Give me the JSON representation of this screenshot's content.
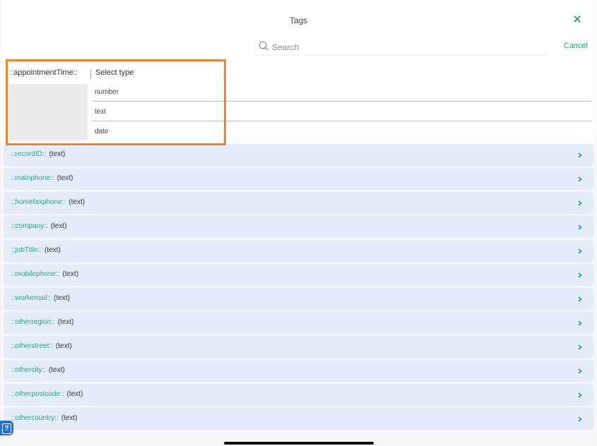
{
  "header": {
    "title": "Tags",
    "close_icon": "x-icon",
    "search_placeholder": "Search",
    "cancel_label": "Cancel"
  },
  "tag_editor": {
    "tag_prefix": "::",
    "tag_name": "appointmentTime",
    "tag_suffix": "::",
    "select_label": "Select type",
    "options": [
      "number",
      "text",
      "date"
    ]
  },
  "fields": [
    {
      "name": "::recordID::",
      "type": "(text)"
    },
    {
      "name": "::mainphone::",
      "type": "(text)"
    },
    {
      "name": "::homefaxphone::",
      "type": "(text)"
    },
    {
      "name": "::company::",
      "type": "(text)"
    },
    {
      "name": "::jobTitle::",
      "type": "(text)"
    },
    {
      "name": "::mobilephone::",
      "type": "(text)"
    },
    {
      "name": "::workemail::",
      "type": "(text)"
    },
    {
      "name": "::otherregion::",
      "type": "(text)"
    },
    {
      "name": "::otherstreet::",
      "type": "(text)"
    },
    {
      "name": "::othercity::",
      "type": "(text)"
    },
    {
      "name": "::otherpostcode::",
      "type": "(text)"
    },
    {
      "name": "::othercountry::",
      "type": "(text)"
    }
  ],
  "colors": {
    "accent": "#1e9e7e",
    "highlight": "#f5832b",
    "row_background": "#e6edfa"
  },
  "help_badge": "?"
}
